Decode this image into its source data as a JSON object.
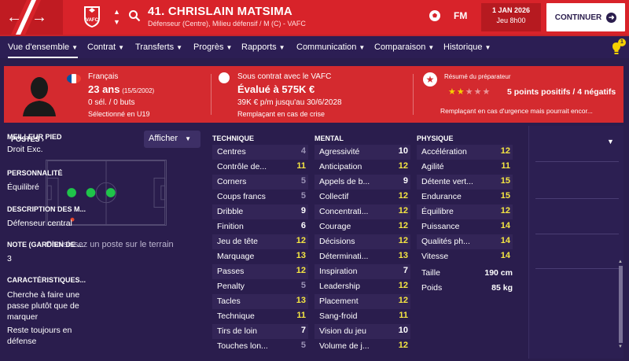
{
  "header": {
    "club_short": "VAFC",
    "player_title": "41. CHRISLAIN MATSIMA",
    "player_subtitle": "Défenseur (Centre), Milieu défensif / M (C) - VAFC",
    "fm_logo": "FM",
    "date_line1": "1 JAN 2026",
    "date_line2": "Jeu 8h00",
    "continue_label": "CONTINUER",
    "accent_color": "#d8232a"
  },
  "tabs": [
    {
      "label": "Vue d'ensemble"
    },
    {
      "label": "Contrat"
    },
    {
      "label": "Transferts"
    },
    {
      "label": "Progrès"
    },
    {
      "label": "Rapports"
    },
    {
      "label": "Communication"
    },
    {
      "label": "Comparaison"
    },
    {
      "label": "Historique"
    }
  ],
  "notifications": {
    "count": "1"
  },
  "info": {
    "nationality": "Français",
    "age": "23 ans",
    "birth": "(15/5/2002)",
    "stats": "0 sél. / 0 buts",
    "selection": "Sélectionné en U19",
    "contract": "Sous contrat avec le VAFC",
    "value": "Évalué à 575K €",
    "wage": "39K € p/m jusqu'au 30/6/2028",
    "role": "Remplaçant en cas de crise",
    "coach_title": "Résumé du préparateur",
    "coach_points": "5 points positifs / 4 négatifs",
    "coach_note": "Remplaçant en cas d'urgence mais pourrait encor...",
    "stars_rating": 2.5,
    "stars_max": 5
  },
  "positions": {
    "title": "POSTES",
    "afficher_label": "Afficher",
    "caption": "Choisissez un poste sur le terrain"
  },
  "attributes": {
    "technique": {
      "title": "TECHNIQUE",
      "items": [
        {
          "name": "Centres",
          "value": "4"
        },
        {
          "name": "Contrôle de...",
          "value": "11"
        },
        {
          "name": "Corners",
          "value": "5"
        },
        {
          "name": "Coups francs",
          "value": "5"
        },
        {
          "name": "Dribble",
          "value": "9"
        },
        {
          "name": "Finition",
          "value": "6"
        },
        {
          "name": "Jeu de tête",
          "value": "12"
        },
        {
          "name": "Marquage",
          "value": "13"
        },
        {
          "name": "Passes",
          "value": "12"
        },
        {
          "name": "Penalty",
          "value": "5"
        },
        {
          "name": "Tacles",
          "value": "13"
        },
        {
          "name": "Technique",
          "value": "11"
        },
        {
          "name": "Tirs de loin",
          "value": "7"
        },
        {
          "name": "Touches lon...",
          "value": "5"
        }
      ]
    },
    "mental": {
      "title": "MENTAL",
      "items": [
        {
          "name": "Agressivité",
          "value": "10"
        },
        {
          "name": "Anticipation",
          "value": "12"
        },
        {
          "name": "Appels de b...",
          "value": "9"
        },
        {
          "name": "Collectif",
          "value": "12"
        },
        {
          "name": "Concentrati...",
          "value": "12"
        },
        {
          "name": "Courage",
          "value": "12"
        },
        {
          "name": "Décisions",
          "value": "12"
        },
        {
          "name": "Déterminati...",
          "value": "13"
        },
        {
          "name": "Inspiration",
          "value": "7"
        },
        {
          "name": "Leadership",
          "value": "12"
        },
        {
          "name": "Placement",
          "value": "12"
        },
        {
          "name": "Sang-froid",
          "value": "11"
        },
        {
          "name": "Vision du jeu",
          "value": "10"
        },
        {
          "name": "Volume de j...",
          "value": "12"
        }
      ]
    },
    "physique": {
      "title": "PHYSIQUE",
      "items": [
        {
          "name": "Accélération",
          "value": "12"
        },
        {
          "name": "Agilité",
          "value": "11"
        },
        {
          "name": "Détente vert...",
          "value": "15"
        },
        {
          "name": "Endurance",
          "value": "15"
        },
        {
          "name": "Équilibre",
          "value": "12"
        },
        {
          "name": "Puissance",
          "value": "14"
        },
        {
          "name": "Qualités ph...",
          "value": "14"
        },
        {
          "name": "Vitesse",
          "value": "14"
        }
      ],
      "height_label": "Taille",
      "height_value": "190 cm",
      "weight_label": "Poids",
      "weight_value": "85 kg"
    }
  },
  "side": {
    "foot_title": "MEILLEUR PIED",
    "foot_value": "Droit Exc.",
    "personality_title": "PERSONNALITÉ",
    "personality_value": "Équilibré",
    "desc_title": "DESCRIPTION DES M...",
    "desc_value": "Défenseur central",
    "note_title": "NOTE (GARDIEN DE ...",
    "note_value": "3",
    "traits_title": "CARACTÉRISTIQUES...",
    "trait1": "Cherche à faire une passe plutôt que de marquer",
    "trait2": "Reste toujours en défense"
  }
}
